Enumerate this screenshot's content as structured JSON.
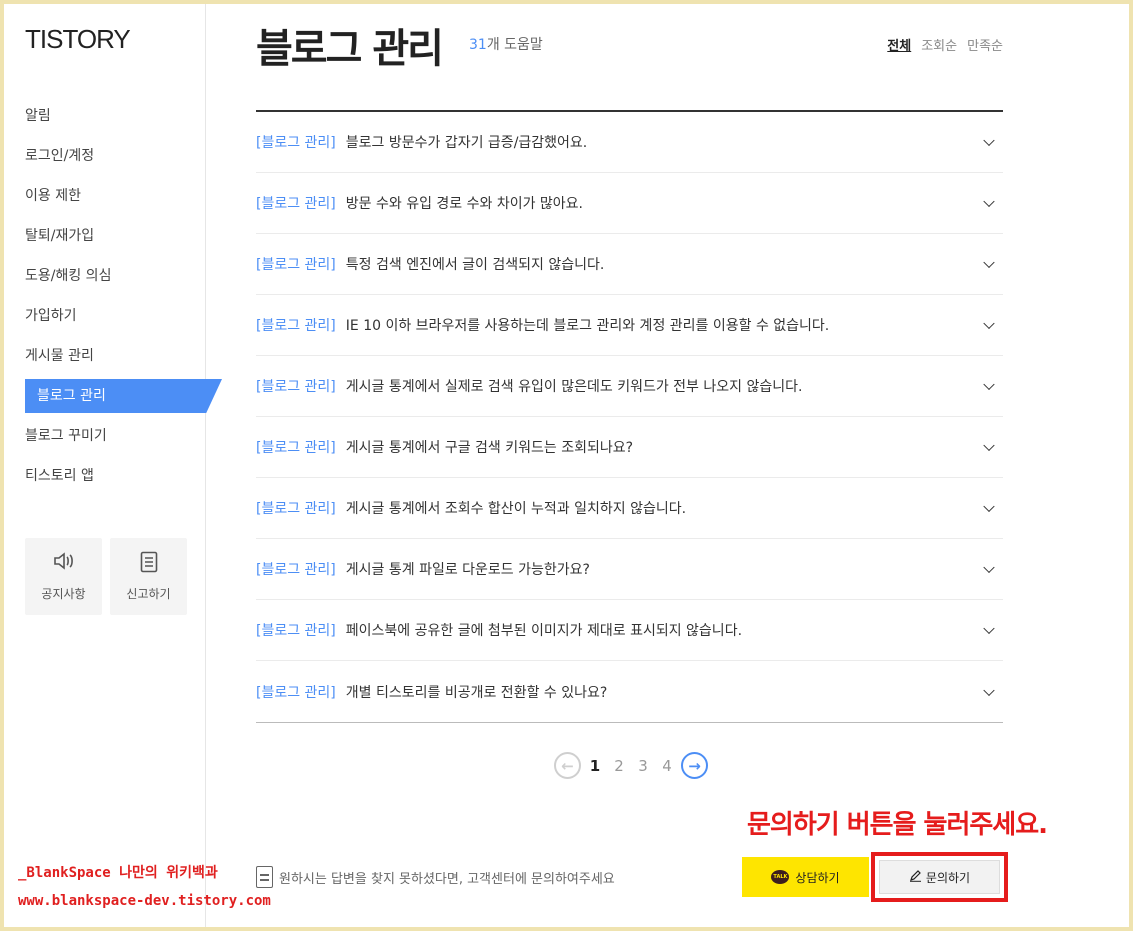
{
  "sidebar": {
    "logo": "TISTORY",
    "items": [
      {
        "label": "알림"
      },
      {
        "label": "로그인/계정"
      },
      {
        "label": "이용 제한"
      },
      {
        "label": "탈퇴/재가입"
      },
      {
        "label": "도용/해킹 의심"
      },
      {
        "label": "가입하기"
      },
      {
        "label": "게시물 관리"
      },
      {
        "label": "블로그 관리"
      },
      {
        "label": "블로그 꾸미기"
      },
      {
        "label": "티스토리 앱"
      }
    ],
    "active_index": 7,
    "notice_label": "공지사항",
    "report_label": "신고하기"
  },
  "header": {
    "title": "블로그 관리",
    "count_num": "31",
    "count_suffix": "개 도움말",
    "sort": [
      "전체",
      "조회순",
      "만족순"
    ],
    "sort_active": "전체"
  },
  "faq": [
    {
      "category": "[블로그 관리]",
      "question": "블로그 방문수가 갑자기 급증/급감했어요."
    },
    {
      "category": "[블로그 관리]",
      "question": "방문 수와 유입 경로 수와 차이가 많아요."
    },
    {
      "category": "[블로그 관리]",
      "question": "특정 검색 엔진에서 글이 검색되지 않습니다."
    },
    {
      "category": "[블로그 관리]",
      "question": "IE 10 이하 브라우저를 사용하는데 블로그 관리와 계정 관리를 이용할 수 없습니다."
    },
    {
      "category": "[블로그 관리]",
      "question": "게시글 통계에서 실제로 검색 유입이 많은데도 키워드가 전부 나오지 않습니다."
    },
    {
      "category": "[블로그 관리]",
      "question": "게시글 통계에서 구글 검색 키워드는 조회되나요?"
    },
    {
      "category": "[블로그 관리]",
      "question": "게시글 통계에서 조회수 합산이 누적과 일치하지 않습니다."
    },
    {
      "category": "[블로그 관리]",
      "question": "게시글 통계 파일로 다운로드 가능한가요?"
    },
    {
      "category": "[블로그 관리]",
      "question": "페이스북에 공유한 글에 첨부된 이미지가 제대로 표시되지 않습니다."
    },
    {
      "category": "[블로그 관리]",
      "question": "개별 티스토리를 비공개로 전환할 수 있나요?"
    }
  ],
  "pagination": {
    "pages": [
      "1",
      "2",
      "3",
      "4"
    ],
    "current": "1",
    "prev_icon": "←",
    "next_icon": "→"
  },
  "callout": "문의하기 버튼을 눌러주세요.",
  "footer": {
    "note": "원하시는 답변을 찾지 못하셨다면, 고객센터에 문의하여주세요",
    "talk_label": "상담하기",
    "talk_icon_text": "TALK",
    "inquiry_label": "문의하기"
  },
  "watermark": {
    "line1": "_BlankSpace 나만의 위키백과",
    "line2": "www.blankspace-dev.tistory.com"
  },
  "colors": {
    "accent": "#4c8ef5",
    "highlight": "#e51c1c",
    "kakao": "#fee500",
    "background": "#efe3b0"
  }
}
